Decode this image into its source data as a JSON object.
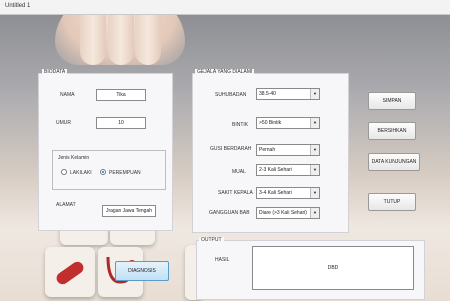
{
  "window": {
    "title": "Untitled 1"
  },
  "biodata": {
    "title": "BIODATA",
    "nama_label": "NAMA",
    "nama_value": "Tika",
    "umur_label": "UMUR",
    "umur_value": "10",
    "jenis_kelamin_label": "Jenis Kelamin",
    "laki_label": "LAKILAKI",
    "perempuan_label": "PEREMPUAN",
    "selected_gender": "PEREMPUAN",
    "alamat_label": "ALAMAT",
    "alamat_value": "Jragan Jawa Tengah"
  },
  "gejala": {
    "title": "GEJALA YANG DIALAMI",
    "suhu_label": "SUHUBADAN",
    "suhu_value": "38.5-40",
    "bintik_label": "BINTIK",
    "bintik_value": ">50 Bintik",
    "gusi_label": "GUSI BERDARAH",
    "gusi_value": "Pernah",
    "mual_label": "MUAL",
    "mual_value": "2-3 Kali Sehari",
    "sakit_label": "SAKIT KEPALA",
    "sakit_value": "3-4 Kali Sehari",
    "bab_label": "GANGGUAN BAB",
    "bab_value": "Diare (>3 Kali Sehari)"
  },
  "buttons": {
    "simpan": "SIMPAN",
    "bersihkan": "BERSIHKAN",
    "data_kunjungan": "DATA KUNJUNGAN",
    "tutup": "TUTUP",
    "diagnosis": "DIAGNOSIS"
  },
  "output": {
    "title": "OUTPUT",
    "hasil_label": "HASIL",
    "hasil_value": "DBD"
  }
}
